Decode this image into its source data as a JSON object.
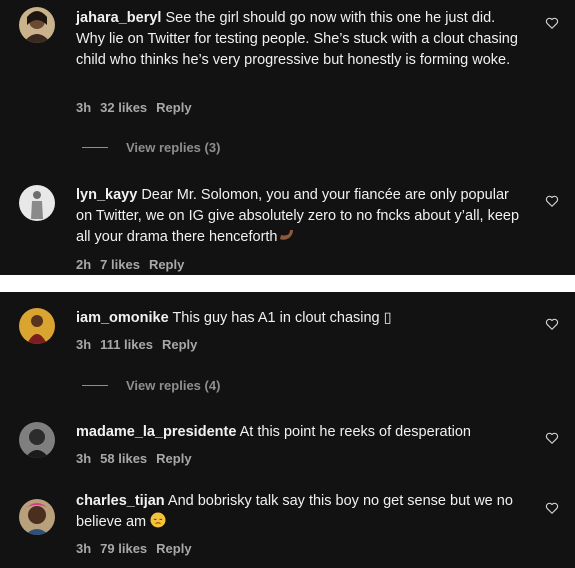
{
  "comments_top": [
    {
      "username": "jahara_beryl",
      "text": "See the girl should go now with this one he just did. Why lie on Twitter for testing people. She’s stuck with a clout chasing child who thinks he’s very progressive but honestly is forming woke.",
      "time": "3h",
      "likes": "32 likes",
      "reply": "Reply",
      "heart_icon": "heart-outline-icon"
    },
    {
      "username": "lyn_kayy",
      "text": "Dear Mr. Solomon, you and your fiancée are only popular on Twitter, we on IG give absolutely zero to no fncks about y’all, keep all your drama there henceforth",
      "emoji": "flexed-arm-emoji",
      "time": "2h",
      "likes": "7 likes",
      "reply": "Reply",
      "heart_icon": "heart-outline-icon"
    }
  ],
  "view_replies_top": "View replies (3)",
  "comments_bottom": [
    {
      "username": "iam_omonike",
      "text": "This guy has A1 in clout chasing ▯",
      "time": "3h",
      "likes": "111 likes",
      "reply": "Reply",
      "heart_icon": "heart-outline-icon"
    },
    {
      "username": "madame_la_presidente",
      "text": "At this point he reeks of desperation",
      "time": "3h",
      "likes": "58 likes",
      "reply": "Reply",
      "heart_icon": "heart-outline-icon"
    },
    {
      "username": "charles_tijan",
      "text": "And bobrisky talk say this boy no get sense but we no believe am",
      "emoji": "pensive-face-emoji",
      "time": "3h",
      "likes": "79 likes",
      "reply": "Reply",
      "heart_icon": "heart-outline-icon"
    }
  ],
  "view_replies_bottom": "View replies (4)",
  "colors": {
    "background": "#121212",
    "text": "#f1f1f1",
    "meta": "#a8a8a8",
    "muted": "#8e8e8e"
  }
}
